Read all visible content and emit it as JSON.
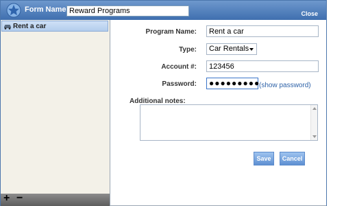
{
  "titlebar": {
    "form_name_label": "Form Name:",
    "form_name_value": "Reward Programs",
    "close_label": "Close",
    "icon": "star-icon"
  },
  "sidebar": {
    "items": [
      {
        "label": "Rent a car",
        "icon": "car-icon",
        "selected": true
      }
    ],
    "add_label": "+",
    "remove_label": "−"
  },
  "form": {
    "program_name": {
      "label": "Program Name:",
      "value": "Rent a car"
    },
    "type": {
      "label": "Type:",
      "value": "Car Rentals"
    },
    "account": {
      "label": "Account #:",
      "value": "123456"
    },
    "password": {
      "label": "Password:",
      "masked": "●●●●●●●●●",
      "show_link": "(show password)"
    },
    "notes": {
      "label": "Additional notes:",
      "value": ""
    },
    "save_label": "Save",
    "cancel_label": "Cancel"
  },
  "colors": {
    "titlebar": "#4f7dba",
    "accent_button": "#6b9cd9",
    "link": "#2e62a8",
    "sidebar_bg": "#f3f1e8",
    "selected_item": "#c2d8f3"
  }
}
